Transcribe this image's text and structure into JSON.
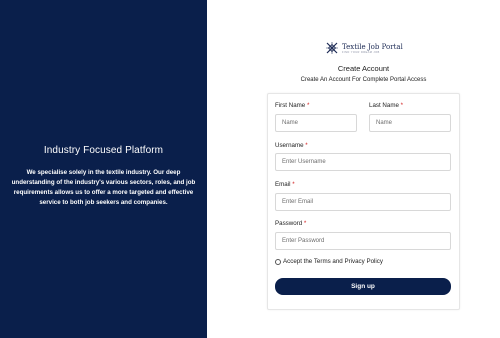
{
  "left_panel": {
    "title": "Industry Focused Platform",
    "description": "We specialise solely in the textile industry. Our deep understanding of the industry's various sectors, roles, and job requirements allows us to offer a more targeted and effective service to both job seekers and companies."
  },
  "brand": {
    "name": "Textile Job Portal",
    "tagline": "FIND YOUR DREAM JOB",
    "logo_icon": "textile-logo-icon"
  },
  "header": {
    "title": "Create Account",
    "subtitle": "Create An Account For Complete Portal Access"
  },
  "form": {
    "required_marker": "*",
    "first_name": {
      "label": "First Name",
      "placeholder": "Name",
      "value": ""
    },
    "last_name": {
      "label": "Last Name",
      "placeholder": "Name",
      "value": ""
    },
    "username": {
      "label": "Username",
      "placeholder": "Enter Username",
      "value": ""
    },
    "email": {
      "label": "Email",
      "placeholder": "Enter Email",
      "value": ""
    },
    "password": {
      "label": "Password",
      "placeholder": "Enter Password",
      "value": ""
    },
    "terms_label": "Accept the Terms and Privacy Policy",
    "terms_checked": false,
    "submit_label": "Sign up"
  },
  "colors": {
    "primary": "#0a1f4b",
    "required": "#d21b1b"
  }
}
